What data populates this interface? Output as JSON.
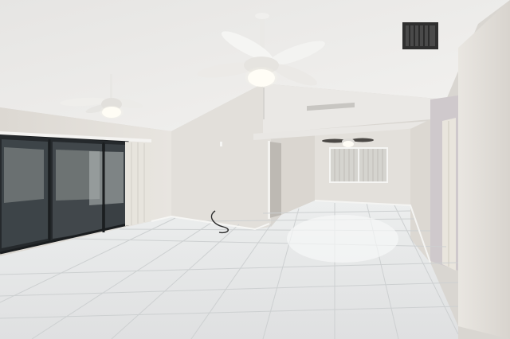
{
  "scene": {
    "kind": "photo",
    "subject": "empty-room-interior",
    "colors": {
      "ceiling": "#efeeec",
      "wall_light": "#e6e3de",
      "wall_shadow": "#cfcbc4",
      "floor_tile": "#e7e8e8",
      "grout": "#cfd1d2",
      "window_dark": "#2a2f33",
      "blind": "#d7d6d2",
      "trim": "#f4f4f2",
      "vent": "#3b3b3b"
    },
    "icons": {
      "fan_large": "ceiling-fan-icon",
      "fan_left": "ceiling-fan-icon",
      "fan_far": "ceiling-fan-icon",
      "vent": "air-vent-icon"
    }
  }
}
